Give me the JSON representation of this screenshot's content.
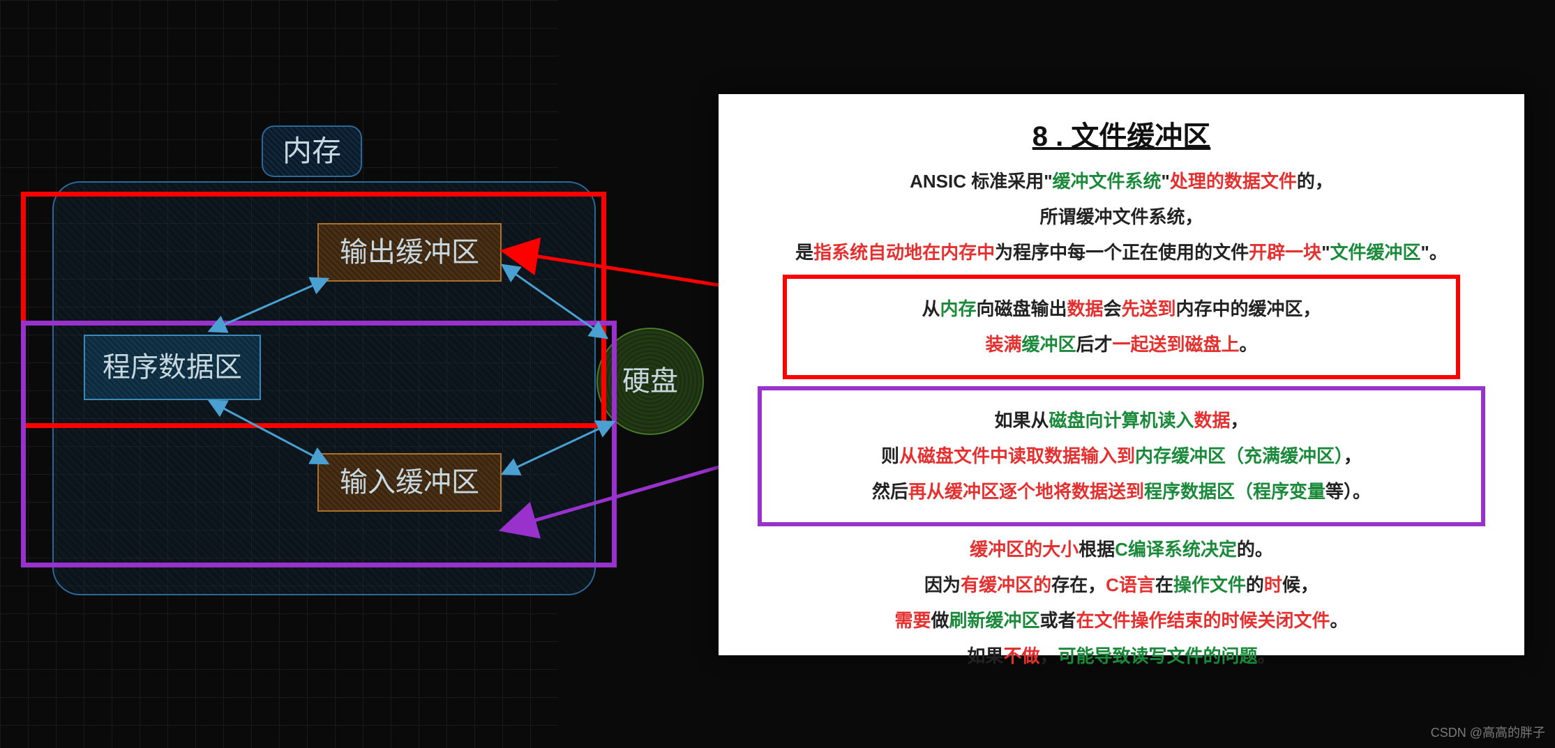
{
  "diagram": {
    "memory_label": "内存",
    "program_data_area": "程序数据区",
    "output_buffer": "输出缓冲区",
    "input_buffer": "输入缓冲区",
    "disk": "硬盘"
  },
  "panel": {
    "title": "8 . 文件缓冲区",
    "line1": {
      "a": "ANSIC 标准采用\"",
      "b": "缓冲文件系统",
      "c": "\"",
      "d": "处理的数据文件",
      "e": "的，"
    },
    "line2": "所谓缓冲文件系统，",
    "line3": {
      "a": "是",
      "b": "指系统自动地在内存中",
      "c": "为程序中每一个正在使用的文件",
      "d": "开辟一块",
      "e": "\"",
      "f": "文件缓冲区",
      "g": "\"。"
    },
    "red_box_line1": {
      "a": "从",
      "b": "内存",
      "c": "向磁盘输出",
      "d": "数据",
      "e": "会",
      "f": "先送到",
      "g": "内存中的缓冲区，"
    },
    "red_box_line2": {
      "a": "装满",
      "b": "缓冲区",
      "c": "后才",
      "d": "一起送到磁盘上",
      "e": "。"
    },
    "purple_box_line1": {
      "a": "如果从",
      "b": "磁盘向计算机读入",
      "c": "数据",
      "d": "，"
    },
    "purple_box_line2": {
      "a": "则",
      "b": "从磁盘文件中读取数据输入到",
      "c": "内存缓冲区（充满缓冲区）",
      "d": "，"
    },
    "purple_box_line3": {
      "a": "然后",
      "b": "再从缓冲区逐个地将数据送到",
      "c": "程序数据区（程序变量",
      "d": "等）。"
    },
    "line4": {
      "a": "缓冲区的大小",
      "b": "根据",
      "c": "C编译系统决定",
      "d": "的。"
    },
    "line5": {
      "a": "因为",
      "b": "有缓冲区的",
      "c": "存在，",
      "d": "C语言",
      "e": "在",
      "f": "操作文件",
      "g": "的",
      "h": "时",
      "i": "候，"
    },
    "line6": {
      "a": "需要",
      "b": "做",
      "c": "刷新缓冲区",
      "d": "或者",
      "e": "在文件操作结束的时候关闭文件",
      "f": "。"
    },
    "line7": {
      "a": "如果",
      "b": "不做",
      "c": "，",
      "d": "可能导致读写文件的问题",
      "e": "。"
    }
  },
  "watermark": "CSDN @高高的胖子"
}
